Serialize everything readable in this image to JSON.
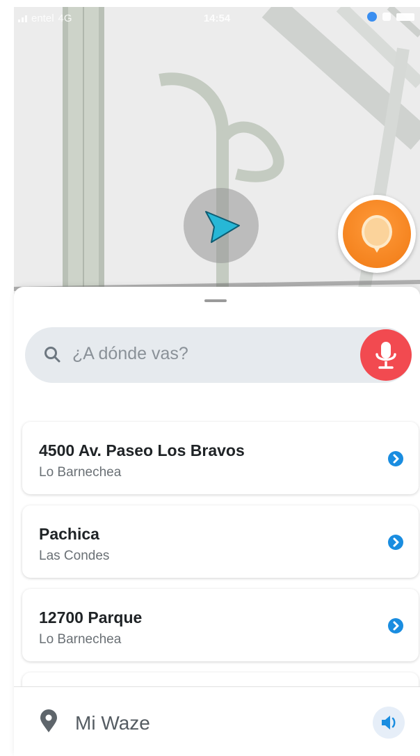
{
  "status_bar": {
    "carrier": "entel",
    "network": "4G",
    "time": "14:54"
  },
  "search": {
    "placeholder": "¿A dónde vas?"
  },
  "recent_destinations": [
    {
      "title": "4500 Av. Paseo Los Bravos",
      "subtitle": "Lo Barnechea"
    },
    {
      "title": "Pachica",
      "subtitle": "Las Condes"
    },
    {
      "title": "12700 Parque",
      "subtitle": "Lo Barnechea"
    }
  ],
  "bottom_bar": {
    "label": "Mi Waze"
  },
  "colors": {
    "accent_blue": "#1a8de0",
    "mic_red": "#f24a50",
    "report_orange": "#f07a14",
    "car_cyan": "#27b7d6"
  }
}
